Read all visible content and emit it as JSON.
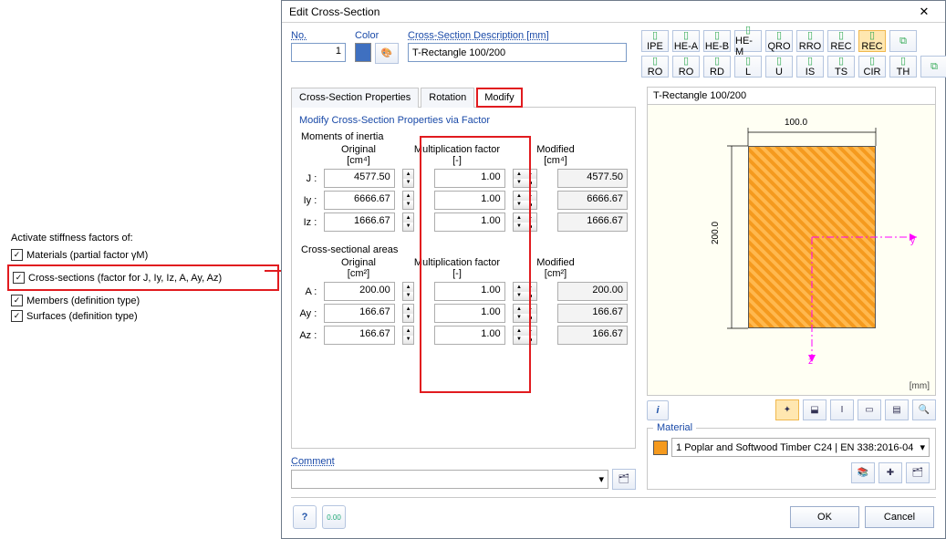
{
  "left": {
    "title": "Activate stiffness factors of:",
    "materials": "Materials (partial factor γM)",
    "cross": "Cross-sections (factor for J, Iy, Iz, A, Ay, Az)",
    "members": "Members (definition type)",
    "surfaces": "Surfaces (definition type)"
  },
  "dialog": {
    "title": "Edit Cross-Section",
    "no_label": "No.",
    "no_value": "1",
    "color_label": "Color",
    "desc_label": "Cross-Section Description [mm]",
    "desc_value": "T-Rectangle 100/200",
    "tabs": {
      "props": "Cross-Section Properties",
      "rot": "Rotation",
      "mod": "Modify"
    },
    "group_title": "Modify Cross-Section Properties via Factor",
    "moments": "Moments of inertia",
    "areas": "Cross-sectional areas",
    "col_orig": "Original",
    "col_mult": "Multiplication factor",
    "col_mod": "Modified",
    "unit_cm4": "[cm⁴]",
    "unit_none": "[-]",
    "unit_cm2": "[cm²]",
    "rows_i": [
      {
        "l": "J :",
        "o": "4577.50",
        "m": "1.00",
        "r": "4577.50"
      },
      {
        "l": "Iy :",
        "o": "6666.67",
        "m": "1.00",
        "r": "6666.67"
      },
      {
        "l": "Iz :",
        "o": "1666.67",
        "m": "1.00",
        "r": "1666.67"
      }
    ],
    "rows_a": [
      {
        "l": "A :",
        "o": "200.00",
        "m": "1.00",
        "r": "200.00"
      },
      {
        "l": "Ay :",
        "o": "166.67",
        "m": "1.00",
        "r": "166.67"
      },
      {
        "l": "Az :",
        "o": "166.67",
        "m": "1.00",
        "r": "166.67"
      }
    ],
    "comment_label": "Comment",
    "preview_title": "T-Rectangle 100/200",
    "dim_w": "100.0",
    "dim_h": "200.0",
    "axis_y": "y",
    "axis_z": "z",
    "unit_mm": "[mm]",
    "material_label": "Material",
    "material_num": "1",
    "material_name": "Poplar and Softwood Timber C24",
    "material_std": "EN 338:2016-04",
    "ok": "OK",
    "cancel": "Cancel"
  },
  "profiles": {
    "r1": [
      "IPE",
      "HE-A",
      "HE-B",
      "HE-M",
      "QRO",
      "RRO",
      "REC",
      "REC"
    ],
    "r2": [
      "RO",
      "RO",
      "RD",
      "L",
      "U",
      "IS",
      "TS",
      "CIR",
      "TH"
    ]
  }
}
